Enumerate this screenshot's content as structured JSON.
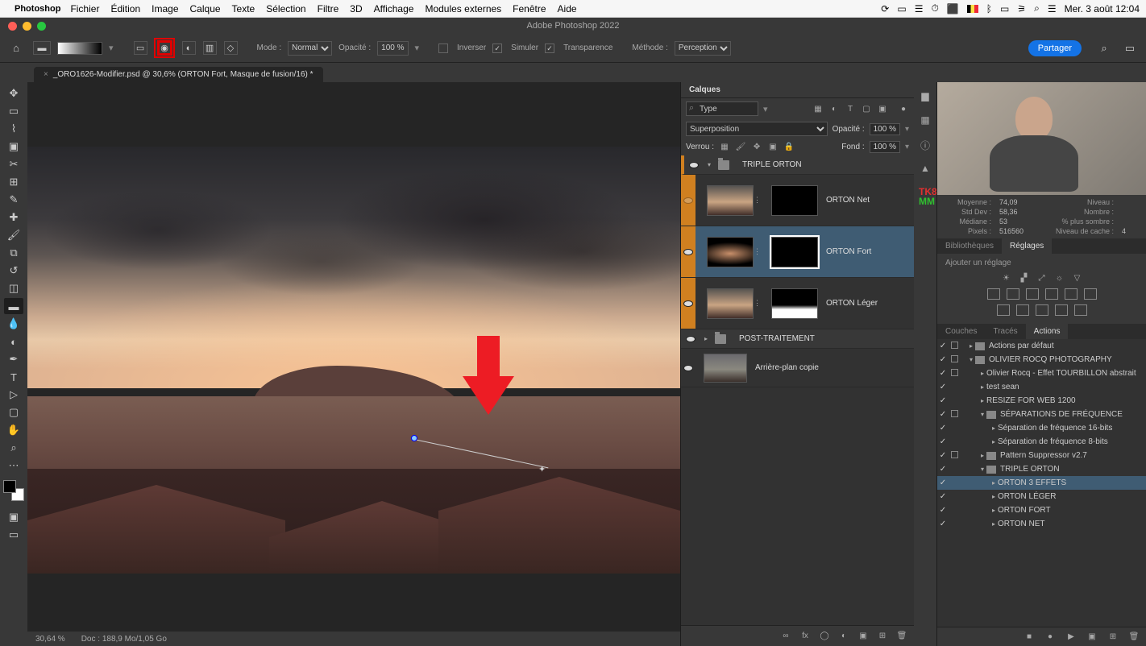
{
  "menubar": {
    "app": "Photoshop",
    "items": [
      "Fichier",
      "Édition",
      "Image",
      "Calque",
      "Texte",
      "Sélection",
      "Filtre",
      "3D",
      "Affichage",
      "Modules externes",
      "Fenêtre",
      "Aide"
    ],
    "clock": "Mer. 3 août  12:04"
  },
  "window": {
    "title": "Adobe Photoshop 2022"
  },
  "doctab": {
    "label": "_ORO1626-Modifier.psd @ 30,6% (ORTON Fort, Masque de fusion/16) *"
  },
  "optbar": {
    "mode_label": "Mode :",
    "mode_value": "Normal",
    "opacity_label": "Opacité :",
    "opacity_value": "100 %",
    "inverser": "Inverser",
    "simuler": "Simuler",
    "transparence": "Transparence",
    "methode_label": "Méthode :",
    "methode_value": "Perception",
    "share": "Partager"
  },
  "layers": {
    "panel_title": "Calques",
    "kind_label": "Type",
    "blend_mode": "Superposition",
    "opacity_label": "Opacité :",
    "opacity_value": "100 %",
    "lock_label": "Verrou :",
    "fill_label": "Fond :",
    "fill_value": "100 %",
    "groups": {
      "g1": "TRIPLE ORTON",
      "g2": "POST-TRAITEMENT"
    },
    "items": {
      "net": "ORTON Net",
      "fort": "ORTON Fort",
      "leger": "ORTON Léger",
      "bg": "Arrière-plan copie"
    }
  },
  "histogram": {
    "mean_l": "Moyenne :",
    "mean_v": "74,09",
    "std_l": "Std Dev :",
    "std_v": "58,36",
    "med_l": "Médiane :",
    "med_v": "53",
    "pix_l": "Pixels :",
    "pix_v": "516560",
    "lvl_l": "Niveau :",
    "cnt_l": "Nombre :",
    "pct_l": "% plus sombre :",
    "cache_l": "Niveau de cache :",
    "cache_v": "4"
  },
  "panels": {
    "biblio": "Bibliothèques",
    "reglages": "Réglages",
    "add_adjust": "Ajouter un réglage",
    "couches": "Couches",
    "traces": "Tracés",
    "actions": "Actions"
  },
  "actions": [
    {
      "lvl": 0,
      "fold": true,
      "tog": ">",
      "name": "Actions par défaut",
      "mod": true
    },
    {
      "lvl": 0,
      "fold": true,
      "tog": "v",
      "name": "OLIVIER ROCQ PHOTOGRAPHY",
      "mod": true
    },
    {
      "lvl": 1,
      "fold": false,
      "tog": ">",
      "name": "Olivier Rocq - Effet TOURBILLON abstrait",
      "mod": true
    },
    {
      "lvl": 1,
      "fold": false,
      "tog": ">",
      "name": "test sean",
      "mod": false
    },
    {
      "lvl": 1,
      "fold": false,
      "tog": ">",
      "name": "RESIZE FOR WEB 1200",
      "mod": false
    },
    {
      "lvl": 1,
      "fold": true,
      "tog": "v",
      "name": "SÉPARATIONS DE FRÉQUENCE",
      "mod": true
    },
    {
      "lvl": 2,
      "fold": false,
      "tog": ">",
      "name": "Séparation de fréquence 16-bits",
      "mod": false
    },
    {
      "lvl": 2,
      "fold": false,
      "tog": ">",
      "name": "Séparation de fréquence 8-bits",
      "mod": false
    },
    {
      "lvl": 1,
      "fold": true,
      "tog": ">",
      "name": "Pattern Suppressor v2.7",
      "mod": true
    },
    {
      "lvl": 1,
      "fold": true,
      "tog": "v",
      "name": "TRIPLE ORTON",
      "mod": false
    },
    {
      "lvl": 2,
      "fold": false,
      "tog": ">",
      "name": "ORTON 3 EFFETS",
      "sel": true,
      "mod": false
    },
    {
      "lvl": 2,
      "fold": false,
      "tog": ">",
      "name": "ORTON LÉGER",
      "mod": false
    },
    {
      "lvl": 2,
      "fold": false,
      "tog": ">",
      "name": "ORTON FORT",
      "mod": false
    },
    {
      "lvl": 2,
      "fold": false,
      "tog": ">",
      "name": "ORTON NET",
      "mod": false
    }
  ],
  "status": {
    "zoom": "30,64 %",
    "doc": "Doc : 188,9 Mo/1,05 Go"
  }
}
